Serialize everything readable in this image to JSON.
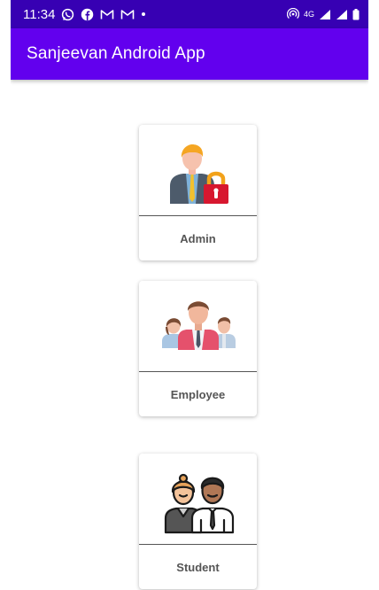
{
  "status_bar": {
    "time": "11:34",
    "network": "4G",
    "icons": [
      "whatsapp-icon",
      "facebook-icon",
      "gmail-icon",
      "gmail-icon",
      "dot-icon",
      "hotspot-icon",
      "signal-icon",
      "signal-icon",
      "battery-icon"
    ]
  },
  "app_bar": {
    "title": "Sanjeevan Android App"
  },
  "cards": [
    {
      "label": "Admin",
      "icon": "admin-lock-icon"
    },
    {
      "label": "Employee",
      "icon": "employee-group-icon"
    },
    {
      "label": "Student",
      "icon": "students-icon"
    }
  ],
  "colors": {
    "status_bar": "#3700b3",
    "app_bar": "#6200ee",
    "card_label": "#555555"
  }
}
